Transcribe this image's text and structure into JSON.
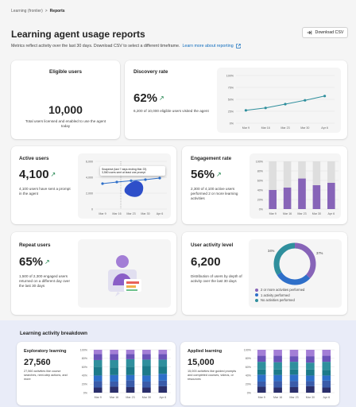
{
  "breadcrumb": {
    "items": [
      "Learning (frontier)",
      "Reports"
    ],
    "separator": ">"
  },
  "page": {
    "title": "Learning agent usage reports",
    "subtitle": "Metrics reflect activity over the last 30 days. Download CSV to select a different timeframe.",
    "learn_more": "Learn more about reporting",
    "download_label": "Download CSV"
  },
  "cards": {
    "eligible": {
      "title": "Eligible users",
      "value": "10,000",
      "desc": "Total users licensed and enabled to use the agent today"
    },
    "discovery": {
      "title": "Discovery rate",
      "value": "62%",
      "desc": "6,200 of 10,000 eligible users visited the agent"
    },
    "active": {
      "title": "Active users",
      "value": "4,100",
      "desc": "4,100 users have sent a prompt in the agent"
    },
    "engagement": {
      "title": "Engagement rate",
      "value": "56%",
      "desc": "2,300 of 4,100 active users performed 2 or more learning activities"
    },
    "repeat": {
      "title": "Repeat users",
      "value": "65%",
      "desc": "1,500 of 2,300 engaged users returned on a different day over the last 30 days"
    },
    "activity": {
      "title": "User activity level",
      "value": "6,200",
      "desc": "Distribution of users by depth of activity over the last 30 days"
    }
  },
  "tooltip": {
    "line1": "Snapshot (last 7 days ending Mar 23)",
    "line2": "3,560 users sent at least one prompt"
  },
  "lower": {
    "title": "Learning activity breakdown",
    "exploratory": {
      "title": "Exploratory learning",
      "value": "27,560",
      "desc": "27,560 activities like course searches, next-step actions, and more"
    },
    "applied": {
      "title": "Applied learning",
      "value": "15,000",
      "desc": "15,000 activities like guided prompts and completed courses, videos, or resources"
    }
  },
  "colors": {
    "accent": "#0f6cbd",
    "teal": "#2f8f9d",
    "purple": "#8764b8",
    "blue": "#2e6fc9",
    "green": "#107c41"
  },
  "icons": {
    "breadcrumb_sep": "chevron-right-icon",
    "download": "download-icon",
    "external": "external-link-icon",
    "trend": "arrow-up-right-icon"
  },
  "chart_data": [
    {
      "type": "line",
      "title": "Discovery rate",
      "x": [
        "Mar 9",
        "Mar 16",
        "Mar 23",
        "Mar 30",
        "Apr 6"
      ],
      "y_ticks": [
        "0%",
        "25%",
        "50%",
        "75%",
        "100%"
      ],
      "ylim": [
        0,
        100
      ],
      "series": [
        {
          "values": [
            27,
            32,
            40,
            48,
            57
          ]
        }
      ]
    },
    {
      "type": "line",
      "title": "Active users",
      "x": [
        "Mar 9",
        "Mar 16",
        "Mar 23",
        "Mar 30",
        "Apr 6"
      ],
      "y_ticks": [
        "0",
        "2,000",
        "4,000",
        "6,000"
      ],
      "ylim": [
        0,
        6000
      ],
      "series": [
        {
          "values": [
            3200,
            3400,
            3560,
            3700,
            3900
          ]
        }
      ]
    },
    {
      "type": "bar",
      "title": "Engagement rate",
      "categories": [
        "Mar 9",
        "Mar 16",
        "Mar 23",
        "Mar 30",
        "Apr 6"
      ],
      "y_ticks": [
        "0%",
        "20%",
        "40%",
        "60%",
        "80%",
        "100%"
      ],
      "ylim": [
        0,
        100
      ],
      "series": [
        {
          "values": [
            40,
            45,
            64,
            50,
            55
          ]
        }
      ]
    },
    {
      "type": "pie",
      "title": "User activity level",
      "slices": [
        {
          "label": "2 or more activities performed",
          "value": 37,
          "display": "37%"
        },
        {
          "label": "1 activity performed",
          "value": 29,
          "display": "29%"
        },
        {
          "label": "No activities performed",
          "value": 34,
          "display": "34%"
        }
      ]
    },
    {
      "type": "bar",
      "title": "Exploratory learning",
      "stacked": true,
      "categories": [
        "Mar 9",
        "Mar 16",
        "Mar 23",
        "Mar 30",
        "Apr 6"
      ],
      "y_ticks": [
        "0%",
        "20%",
        "40%",
        "60%",
        "80%",
        "100%"
      ],
      "ylim": [
        0,
        100
      ],
      "series": [
        {
          "values": [
            12,
            14,
            13,
            12,
            15
          ]
        },
        {
          "values": [
            15,
            12,
            16,
            14,
            13
          ]
        },
        {
          "values": [
            13,
            15,
            12,
            14,
            16
          ]
        },
        {
          "values": [
            20,
            18,
            19,
            22,
            17
          ]
        },
        {
          "values": [
            16,
            17,
            18,
            15,
            16
          ]
        },
        {
          "values": [
            14,
            14,
            12,
            13,
            13
          ]
        },
        {
          "values": [
            10,
            10,
            10,
            10,
            10
          ]
        }
      ]
    },
    {
      "type": "bar",
      "title": "Applied learning",
      "stacked": true,
      "categories": [
        "Mar 9",
        "Mar 16",
        "Mar 23",
        "Mar 30",
        "Apr 6"
      ],
      "y_ticks": [
        "0%",
        "20%",
        "40%",
        "60%",
        "80%",
        "100%"
      ],
      "ylim": [
        0,
        100
      ],
      "series": [
        {
          "values": [
            14,
            12,
            13,
            15,
            12
          ]
        },
        {
          "values": [
            12,
            15,
            14,
            12,
            16
          ]
        },
        {
          "values": [
            16,
            14,
            15,
            13,
            12
          ]
        },
        {
          "values": [
            12,
            13,
            12,
            14,
            13
          ]
        },
        {
          "values": [
            18,
            17,
            18,
            16,
            19
          ]
        },
        {
          "values": [
            14,
            15,
            13,
            15,
            14
          ]
        },
        {
          "values": [
            14,
            14,
            15,
            15,
            14
          ]
        }
      ]
    }
  ]
}
